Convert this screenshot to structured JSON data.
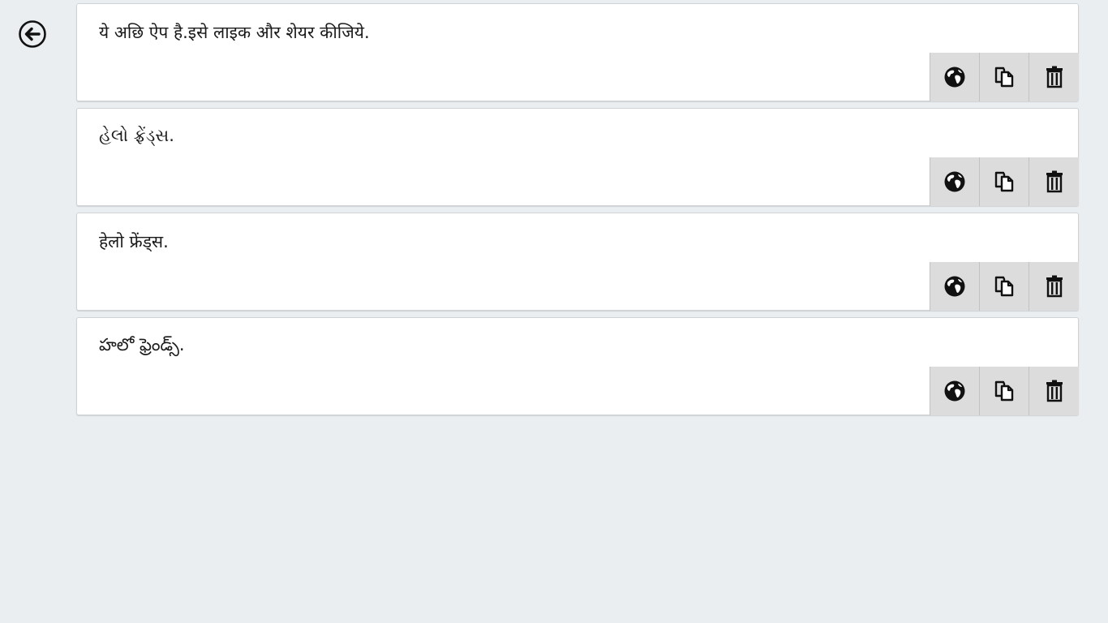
{
  "header": {
    "back_icon": "back-arrow-circle-icon"
  },
  "items": [
    {
      "text": "ये अछि ऐप है.इसे लाइक और शेयर कीजिये."
    },
    {
      "text": "હેલો ફ્રેંડ્સ."
    },
    {
      "text": "हेलो फ्रेंड्स."
    },
    {
      "text": "హలో ఫ్రెండ్స్."
    }
  ],
  "actions": {
    "translate_icon": "globe-icon",
    "copy_icon": "copy-icon",
    "delete_icon": "trash-icon"
  },
  "colors": {
    "background": "#ebeef1",
    "card": "#ffffff",
    "action_button": "#dcdcdc"
  }
}
